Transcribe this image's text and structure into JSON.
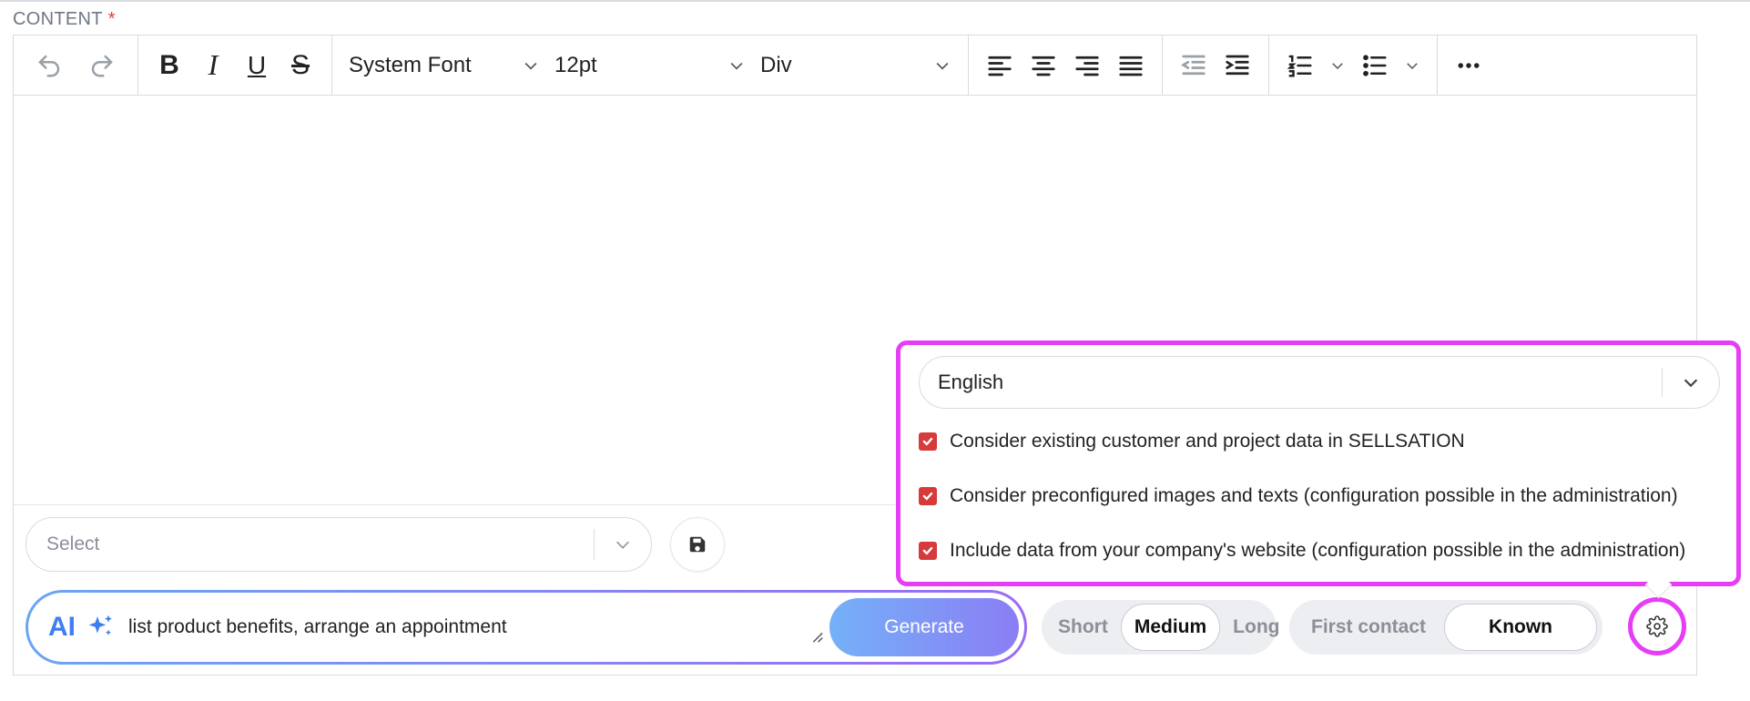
{
  "content_label": "CONTENT",
  "required_mark": "*",
  "toolbar": {
    "font_family": "System Font",
    "font_size": "12pt",
    "block_format": "Div",
    "bold": "B",
    "italic": "I",
    "underline": "U",
    "strike": "S"
  },
  "template_select": {
    "placeholder": "Select"
  },
  "ai": {
    "logo": "AI",
    "prompt": "list product benefits, arrange an appointment",
    "generate_label": "Generate"
  },
  "length": {
    "options": [
      "Short",
      "Medium",
      "Long"
    ],
    "selected": "Medium"
  },
  "contact": {
    "options": [
      "First contact",
      "Known"
    ],
    "selected": "Known"
  },
  "settings_popover": {
    "language": "English",
    "options": [
      {
        "label": "Consider existing customer and project data in SELLSATION",
        "checked": true
      },
      {
        "label": "Consider preconfigured images and texts (configuration possible in the administration)",
        "checked": true
      },
      {
        "label": "Include data from your company's website (configuration possible in the administration)",
        "checked": true
      }
    ]
  },
  "colors": {
    "accent": "#3e7ef0",
    "highlight": "#e53ef5",
    "checkbox": "#d63a3a"
  }
}
